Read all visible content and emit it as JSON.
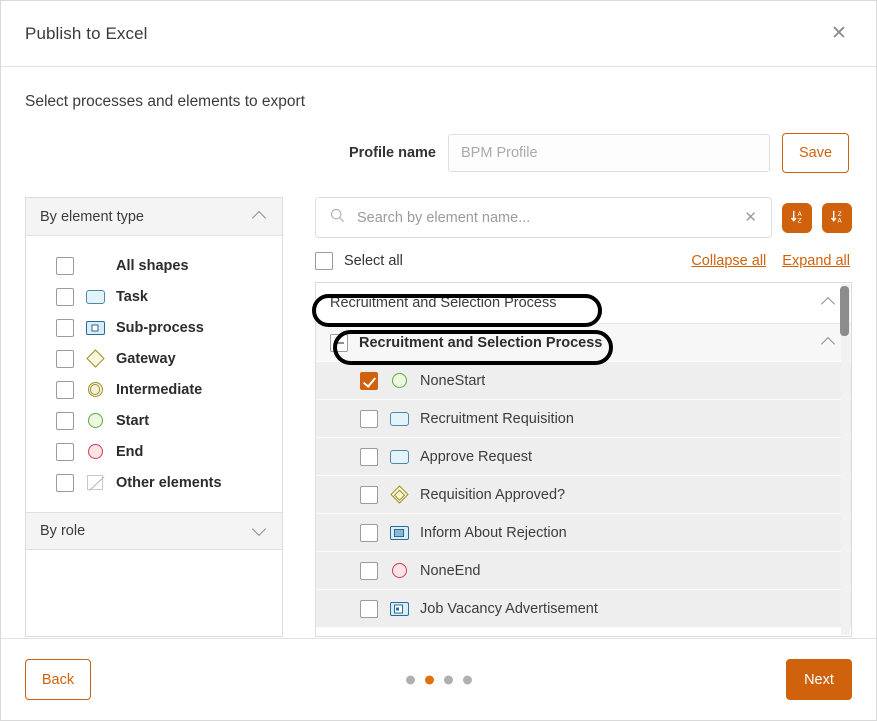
{
  "dialog": {
    "title": "Publish to Excel",
    "close_icon": "close-icon",
    "subtitle": "Select processes and elements to export"
  },
  "profile": {
    "label": "Profile name",
    "value": "",
    "placeholder": "BPM Profile",
    "save_label": "Save"
  },
  "filters": {
    "groups": [
      {
        "title": "By element type",
        "expanded": true,
        "chevron": "chevron-up-icon"
      },
      {
        "title": "By role",
        "expanded": false,
        "chevron": "chevron-down-icon"
      }
    ],
    "element_types": [
      {
        "label": "All shapes",
        "checked": false,
        "shape": "none"
      },
      {
        "label": "Task",
        "checked": false,
        "shape": "task"
      },
      {
        "label": "Sub-process",
        "checked": false,
        "shape": "sub-process"
      },
      {
        "label": "Gateway",
        "checked": false,
        "shape": "gateway"
      },
      {
        "label": "Intermediate",
        "checked": false,
        "shape": "intermediate"
      },
      {
        "label": "Start",
        "checked": false,
        "shape": "start"
      },
      {
        "label": "End",
        "checked": false,
        "shape": "end"
      },
      {
        "label": "Other elements",
        "checked": false,
        "shape": "other"
      }
    ]
  },
  "search": {
    "value": "",
    "placeholder": "Search by element name...",
    "search_icon": "search-icon",
    "clear_icon": "clear-icon",
    "sort_asc_icon": "sort-ascending-icon",
    "sort_desc_icon": "sort-descending-icon"
  },
  "toolbar": {
    "select_all_label": "Select all",
    "select_all_checked": false,
    "collapse_all_label": "Collapse all",
    "expand_all_label": "Expand all"
  },
  "tree": {
    "process_header": {
      "label": "Recruitment and Selection Process",
      "chevron": "chevron-up-icon"
    },
    "nodes": [
      {
        "label": "Recruitment and Selection Process",
        "level": 1,
        "check_state": "indeterminate",
        "shape": "none",
        "chevron": "chevron-up-icon",
        "highlighted": true
      },
      {
        "label": "NoneStart",
        "level": 2,
        "check_state": "checked",
        "shape": "start",
        "highlighted": true
      },
      {
        "label": "Recruitment Requisition",
        "level": 2,
        "check_state": "unchecked",
        "shape": "task",
        "highlighted": false
      },
      {
        "label": "Approve Request",
        "level": 2,
        "check_state": "unchecked",
        "shape": "task",
        "highlighted": false
      },
      {
        "label": "Requisition Approved?",
        "level": 2,
        "check_state": "unchecked",
        "shape": "gateway",
        "highlighted": false
      },
      {
        "label": "Inform About Rejection",
        "level": 2,
        "check_state": "unchecked",
        "shape": "send-task",
        "highlighted": false
      },
      {
        "label": "NoneEnd",
        "level": 2,
        "check_state": "unchecked",
        "shape": "end",
        "highlighted": false
      },
      {
        "label": "Job Vacancy Advertisement",
        "level": 2,
        "check_state": "unchecked",
        "shape": "receive-task",
        "highlighted": false
      }
    ]
  },
  "footer": {
    "back_label": "Back",
    "next_label": "Next",
    "dots_total": 4,
    "dots_active_index": 1
  },
  "colors": {
    "accent": "#d0620d",
    "dot_active": "#e1710d",
    "dot_inactive": "#b0b0b0",
    "row_bg": "#eeeeee"
  }
}
